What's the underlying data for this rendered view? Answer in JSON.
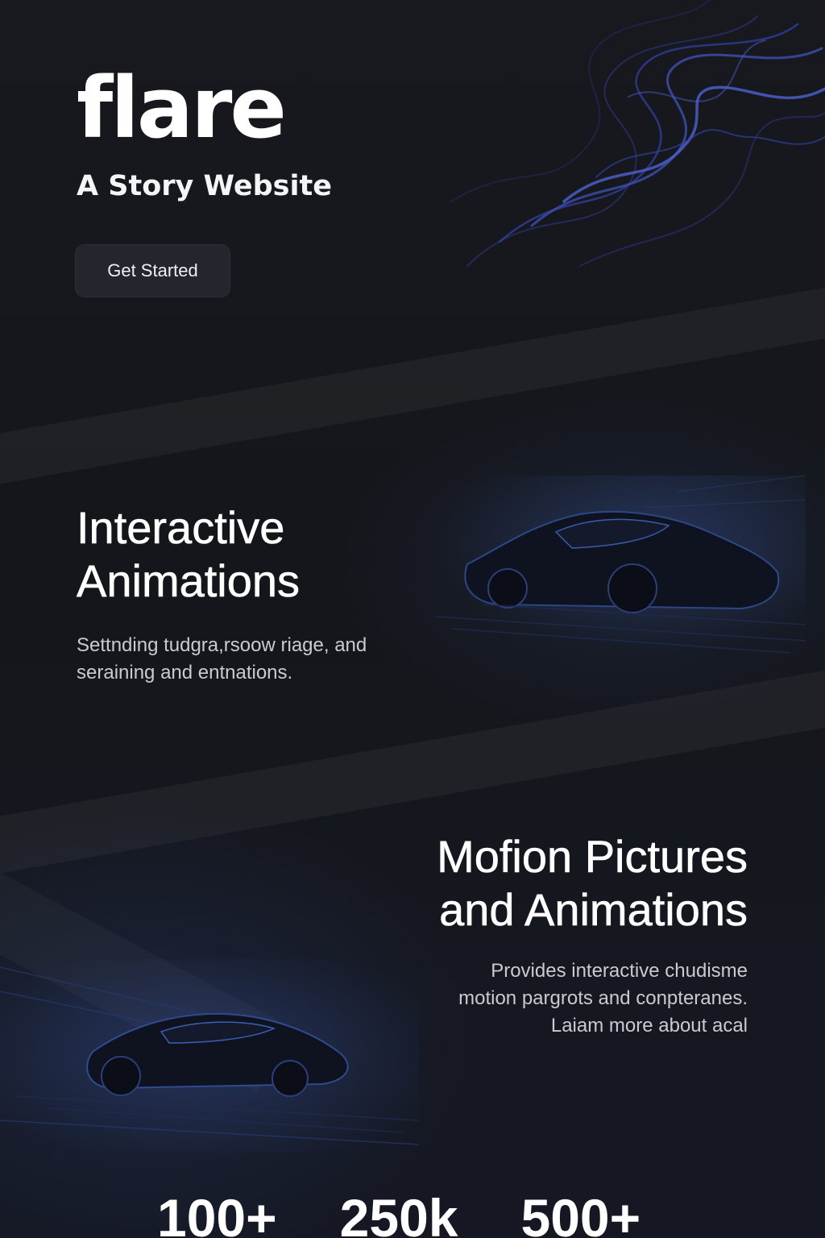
{
  "brand": {
    "logo_text": "flare",
    "tagline": "A Story Website"
  },
  "hero": {
    "cta_label": "Get Started"
  },
  "section_interactive": {
    "title_line1": "Interactive",
    "title_line2": "Animations",
    "desc_line1": "Settnding tudgra,rsoow riage, and",
    "desc_line2": "seraining and entnations."
  },
  "section_motion": {
    "title_line1": "Mofion Pictures",
    "title_line2": "and Animations",
    "desc_line1": "Provides interactive chudisme",
    "desc_line2": "motion pargrots and conpteranes.",
    "desc_line3": "Laiam more about acal"
  },
  "stats": [
    "100+",
    "250k",
    "500+"
  ],
  "colors": {
    "background": "#15171d",
    "accent_blue": "#3d4fb0",
    "button_bg": "#23262c"
  }
}
